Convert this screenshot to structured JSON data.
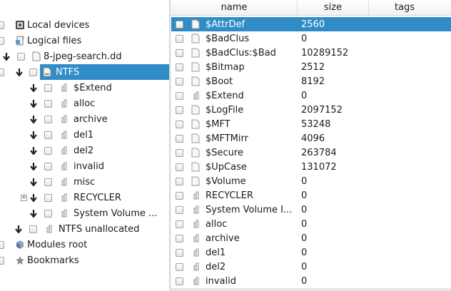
{
  "tree": {
    "rows": [
      {
        "label": "Local devices",
        "icon": "local-devices-icon"
      },
      {
        "label": "Logical files",
        "icon": "logical-files-icon"
      },
      {
        "label": "8-jpeg-search.dd",
        "icon": "disk-image-icon"
      },
      {
        "label": "NTFS",
        "icon": "volume-icon",
        "selected": true
      },
      {
        "label": "$Extend",
        "icon": "folder-icon"
      },
      {
        "label": "alloc",
        "icon": "folder-icon"
      },
      {
        "label": "archive",
        "icon": "folder-icon"
      },
      {
        "label": "del1",
        "icon": "folder-icon"
      },
      {
        "label": "del2",
        "icon": "folder-icon"
      },
      {
        "label": "invalid",
        "icon": "folder-icon"
      },
      {
        "label": "misc",
        "icon": "folder-icon"
      },
      {
        "label": "RECYCLER",
        "icon": "folder-icon"
      },
      {
        "label": "System Volume ...",
        "icon": "folder-icon"
      },
      {
        "label": "NTFS unallocated",
        "icon": "folder-icon"
      },
      {
        "label": "Modules root",
        "icon": "modules-icon"
      },
      {
        "label": "Bookmarks",
        "icon": "star-icon"
      }
    ]
  },
  "table": {
    "headers": {
      "name": "name",
      "size": "size",
      "tags": "tags"
    },
    "rows": [
      {
        "name": "$AttrDef",
        "size": "2560",
        "type": "file",
        "selected": true
      },
      {
        "name": "$BadClus",
        "size": "0",
        "type": "file"
      },
      {
        "name": "$BadClus:$Bad",
        "size": "10289152",
        "type": "file"
      },
      {
        "name": "$Bitmap",
        "size": "2512",
        "type": "file"
      },
      {
        "name": "$Boot",
        "size": "8192",
        "type": "file"
      },
      {
        "name": "$Extend",
        "size": "0",
        "type": "folder"
      },
      {
        "name": "$LogFile",
        "size": "2097152",
        "type": "file"
      },
      {
        "name": "$MFT",
        "size": "53248",
        "type": "file"
      },
      {
        "name": "$MFTMirr",
        "size": "4096",
        "type": "file"
      },
      {
        "name": "$Secure",
        "size": "263784",
        "type": "file"
      },
      {
        "name": "$UpCase",
        "size": "131072",
        "type": "file"
      },
      {
        "name": "$Volume",
        "size": "0",
        "type": "file"
      },
      {
        "name": "RECYCLER",
        "size": "0",
        "type": "folder"
      },
      {
        "name": "System Volume I...",
        "size": "0",
        "type": "folder"
      },
      {
        "name": "alloc",
        "size": "0",
        "type": "folder"
      },
      {
        "name": "archive",
        "size": "0",
        "type": "folder"
      },
      {
        "name": "del1",
        "size": "0",
        "type": "folder"
      },
      {
        "name": "del2",
        "size": "0",
        "type": "folder"
      },
      {
        "name": "invalid",
        "size": "0",
        "type": "folder"
      }
    ]
  },
  "colors": {
    "selection": "#308cc6",
    "background": "#ffffff"
  }
}
